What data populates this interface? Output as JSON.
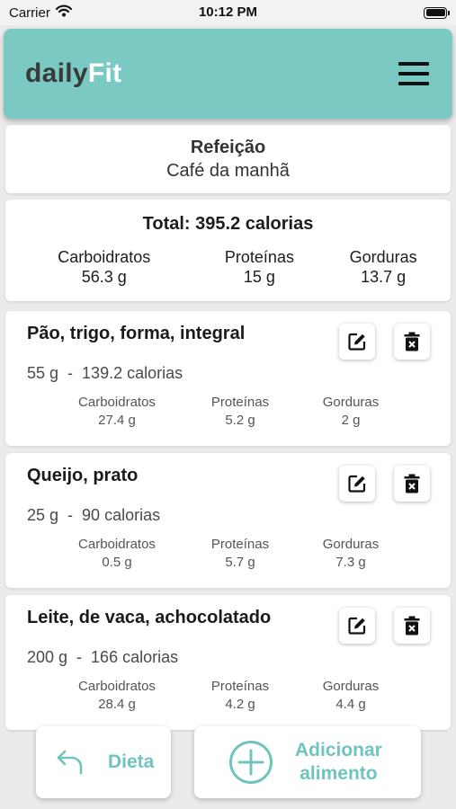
{
  "status_bar": {
    "carrier": "Carrier",
    "time": "10:12 PM"
  },
  "header": {
    "logo_part1": "daily",
    "logo_part2": "Fit"
  },
  "meal": {
    "label": "Refeição",
    "name": "Café da manhã"
  },
  "total": {
    "title": "Total: 395.2 calorias",
    "macros": [
      {
        "label": "Carboidratos",
        "value": "56.3 g"
      },
      {
        "label": "Proteínas",
        "value": "15 g"
      },
      {
        "label": "Gorduras",
        "value": "13.7 g"
      }
    ]
  },
  "foods": [
    {
      "name": "Pão, trigo, forma, integral",
      "quantity": "55 g",
      "separator": "-",
      "calories": "139.2 calorias",
      "macros": [
        {
          "label": "Carboidratos",
          "value": "27.4 g"
        },
        {
          "label": "Proteínas",
          "value": "5.2 g"
        },
        {
          "label": "Gorduras",
          "value": "2 g"
        }
      ]
    },
    {
      "name": "Queijo, prato",
      "quantity": "25 g",
      "separator": "-",
      "calories": "90 calorias",
      "macros": [
        {
          "label": "Carboidratos",
          "value": "0.5 g"
        },
        {
          "label": "Proteínas",
          "value": "5.7 g"
        },
        {
          "label": "Gorduras",
          "value": "7.3 g"
        }
      ]
    },
    {
      "name": "Leite, de vaca, achocolatado",
      "quantity": "200 g",
      "separator": "-",
      "calories": "166 calorias",
      "macros": [
        {
          "label": "Carboidratos",
          "value": "28.4 g"
        },
        {
          "label": "Proteínas",
          "value": "4.2 g"
        },
        {
          "label": "Gorduras",
          "value": "4.4 g"
        }
      ]
    }
  ],
  "bottom": {
    "diet_label": "Dieta",
    "add_label_line1": "Adicionar",
    "add_label_line2": "alimento"
  },
  "colors": {
    "accent": "#7ac9c3",
    "button_text": "#6fc4bd",
    "background": "#ebebeb"
  },
  "icons": [
    "wifi-icon",
    "battery-icon",
    "menu-icon",
    "edit-icon",
    "delete-icon",
    "undo-arrow-icon",
    "plus-circle-icon"
  ]
}
